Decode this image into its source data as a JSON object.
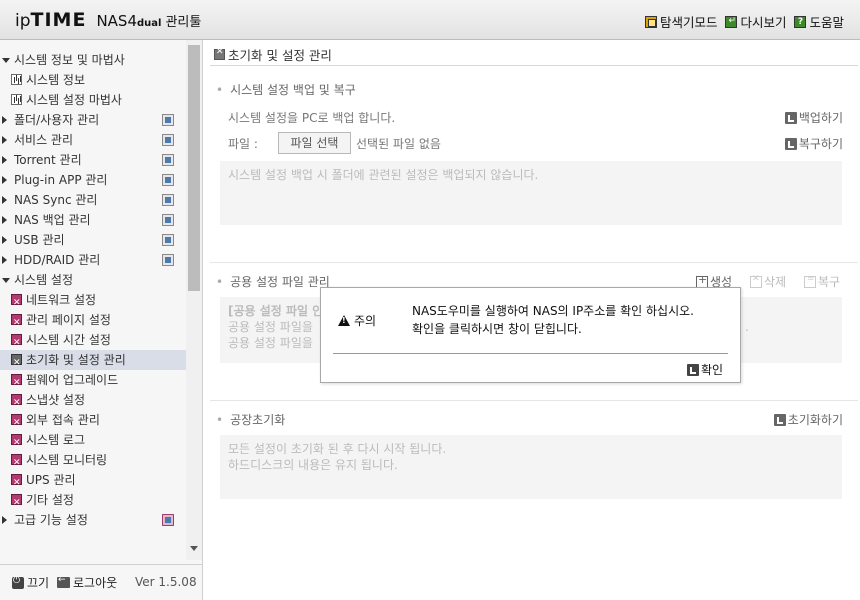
{
  "header": {
    "logo_ip": "ip",
    "logo_time": "TIME",
    "logo_nas": "NAS4",
    "logo_dual": "dual",
    "logo_manager": "관리툴",
    "links": [
      {
        "label": "탐색기모드",
        "icon": "explorer-icon"
      },
      {
        "label": "다시보기",
        "icon": "refresh-icon"
      },
      {
        "label": "도움말",
        "icon": "help-icon"
      }
    ]
  },
  "sidebar": {
    "items": [
      {
        "label": "시스템 정보 및 마법사"
      },
      {
        "label": "시스템 정보"
      },
      {
        "label": "시스템 설정 마법사"
      },
      {
        "label": "폴더/사용자 관리"
      },
      {
        "label": "서비스 관리"
      },
      {
        "label": "Torrent 관리"
      },
      {
        "label": "Plug-in APP 관리"
      },
      {
        "label": "NAS Sync 관리"
      },
      {
        "label": "NAS 백업 관리"
      },
      {
        "label": "USB 관리"
      },
      {
        "label": "HDD/RAID 관리"
      },
      {
        "label": "시스템 설정"
      },
      {
        "label": "네트워크 설정"
      },
      {
        "label": "관리 페이지 설정"
      },
      {
        "label": "시스템 시간 설정"
      },
      {
        "label": "초기화 및 설정 관리"
      },
      {
        "label": "펌웨어 업그레이드"
      },
      {
        "label": "스냅샷 설정"
      },
      {
        "label": "외부 접속 관리"
      },
      {
        "label": "시스템 로그"
      },
      {
        "label": "시스템 모니터링"
      },
      {
        "label": "UPS 관리"
      },
      {
        "label": "기타 설정"
      },
      {
        "label": "고급 기능 설정"
      }
    ],
    "power_label": "끄기",
    "logout_label": "로그아웃",
    "version": "Ver 1.5.08"
  },
  "main": {
    "page_title": "초기화 및 설정 관리",
    "backup": {
      "heading": "시스템 설정 백업 및 복구",
      "backup_text": "시스템 설정을 PC로 백업 합니다.",
      "backup_action": "백업하기",
      "file_label": "파일 :",
      "file_button": "파일 선택",
      "file_status": "선택된 파일 없음",
      "restore_action": "복구하기",
      "note": "시스템 설정 백업 시 폴더에 관련된 설정은 백업되지 않습니다."
    },
    "shared": {
      "heading": "공용 설정 파일 관리",
      "create_label": "생성",
      "delete_label": "삭제",
      "restore_label": "복구",
      "lines": [
        "[공용 설정 파일 안",
        "공용 설정 파일을",
        "공용 설정 파일을"
      ],
      "trailing": ".",
      "trailing2": "."
    },
    "factory": {
      "heading": "공장초기화",
      "action": "초기화하기",
      "lines": [
        "모든 설정이 초기화 된 후 다시 시작 됩니다.",
        "하드디스크의 내용은 유지 됩니다."
      ]
    }
  },
  "dialog": {
    "title": "주의",
    "messages": [
      "NAS도우미를 실행하여 NAS의 IP주소를 확인 하십시오.",
      "확인을 클릭하시면 창이 닫힙니다."
    ],
    "ok_label": "확인"
  }
}
